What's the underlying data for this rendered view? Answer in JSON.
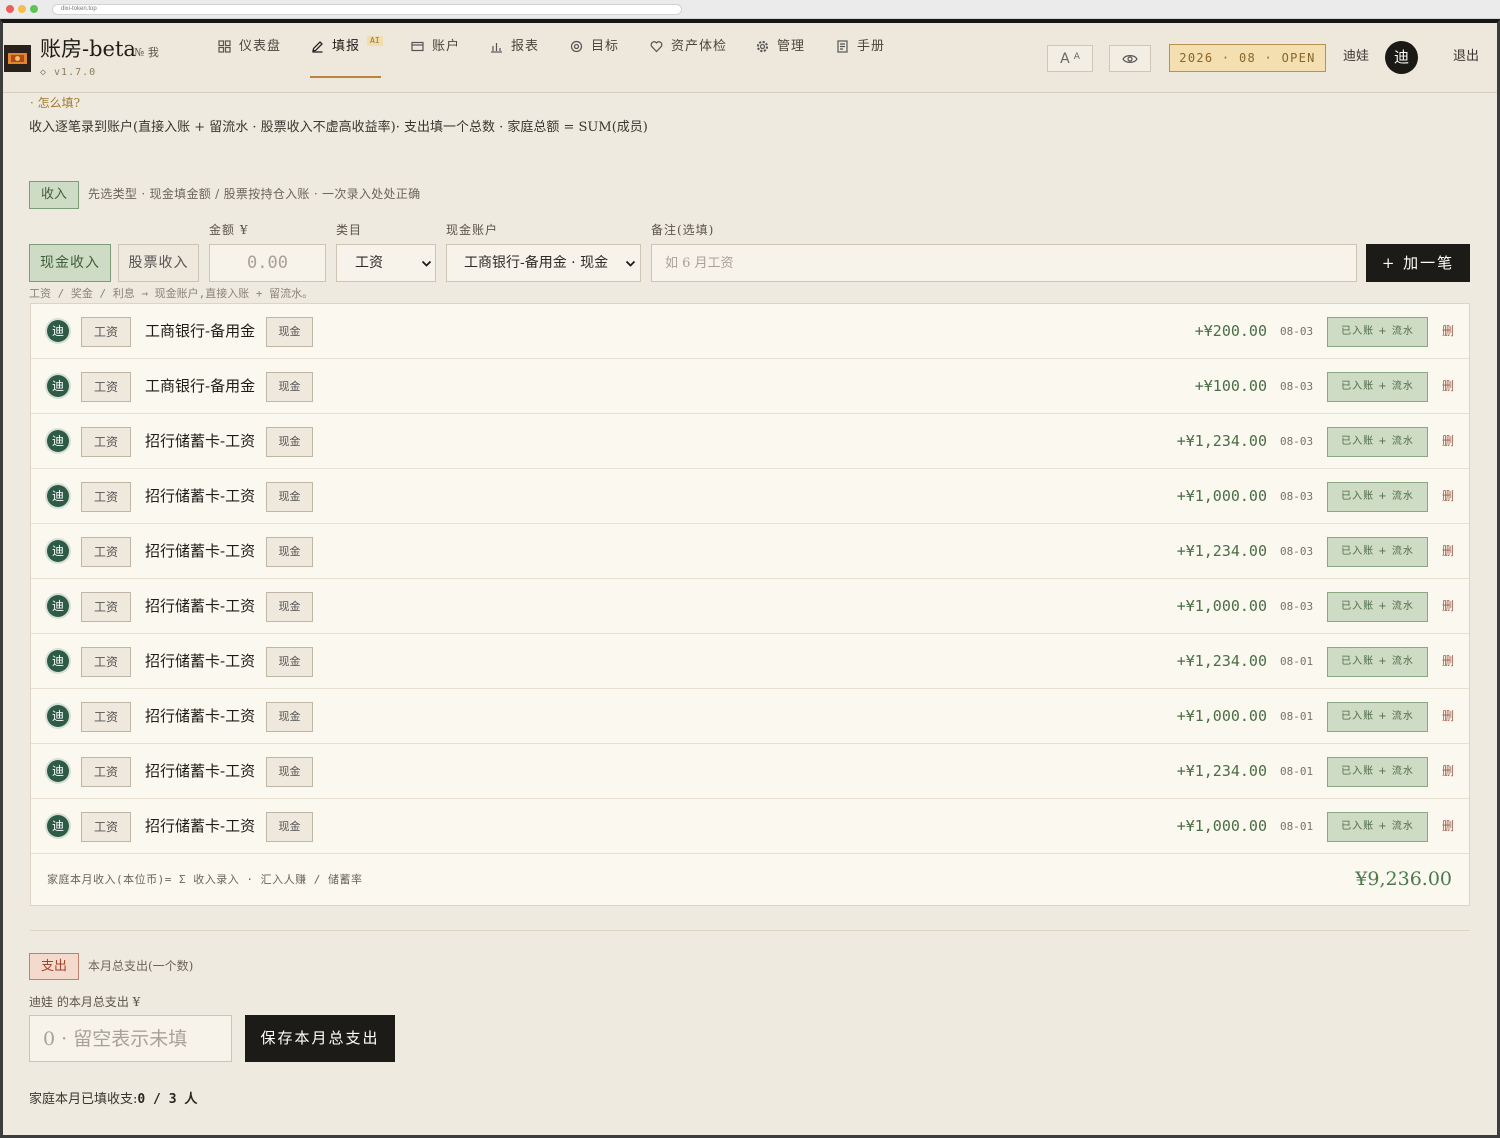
{
  "browser": {
    "url": "dixi-token.top"
  },
  "header": {
    "brand": "账房-beta",
    "brand_mark": "№ 我",
    "version": "◇ v1.7.0",
    "logo_icon": "ledger-logo-icon",
    "nav": [
      {
        "label": "仪表盘",
        "icon": "grid-icon"
      },
      {
        "label": "填报",
        "icon": "pencil-icon",
        "badge": "AI",
        "active": true
      },
      {
        "label": "账户",
        "icon": "card-icon"
      },
      {
        "label": "报表",
        "icon": "bar-chart-icon"
      },
      {
        "label": "目标",
        "icon": "target-icon"
      },
      {
        "label": "资产体检",
        "icon": "heart-icon"
      },
      {
        "label": "管理",
        "icon": "gear-icon"
      },
      {
        "label": "手册",
        "icon": "document-icon"
      }
    ],
    "font_toggle": {
      "large": "A",
      "small": "A"
    },
    "privacy_toggle_icon": "eye-icon",
    "period": "2026 · 08 · OPEN",
    "user_name": "迪娃",
    "avatar_initial": "迪",
    "logout": "退出"
  },
  "help": {
    "toggle": "· 怎么填?",
    "text": "收入逐笔录到账户(直接入账 + 留流水 · 股票收入不虚高收益率)· 支出填一个总数 · 家庭总额 = SUM(成员)"
  },
  "income": {
    "tag": "收入",
    "subtitle": "先选类型 · 现金填金额 / 股票按持仓入账 · 一次录入处处正确",
    "labels": {
      "amount": "金额 ¥",
      "category": "类目",
      "account": "现金账户",
      "note": "备注(选填)"
    },
    "types": [
      {
        "label": "现金收入",
        "selected": true
      },
      {
        "label": "股票收入",
        "selected": false
      }
    ],
    "amount_placeholder": "0.00",
    "category": "工资",
    "account": "工商银行-备用金 · 现金",
    "note_placeholder": "如 6 月工资",
    "add_button": "+ 加一笔",
    "hint": "工资 / 奖金 / 利息 → 现金账户,直接入账 + 留流水。",
    "entries": [
      {
        "member": "迪",
        "category": "工资",
        "account": "工商银行-备用金",
        "account_type": "现金",
        "amount": "+¥200.00",
        "date": "08-03",
        "status": "已入账 + 流水",
        "delete_label": "删"
      },
      {
        "member": "迪",
        "category": "工资",
        "account": "工商银行-备用金",
        "account_type": "现金",
        "amount": "+¥100.00",
        "date": "08-03",
        "status": "已入账 + 流水",
        "delete_label": "删"
      },
      {
        "member": "迪",
        "category": "工资",
        "account": "招行储蓄卡-工资",
        "account_type": "现金",
        "amount": "+¥1,234.00",
        "date": "08-03",
        "status": "已入账 + 流水",
        "delete_label": "删"
      },
      {
        "member": "迪",
        "category": "工资",
        "account": "招行储蓄卡-工资",
        "account_type": "现金",
        "amount": "+¥1,000.00",
        "date": "08-03",
        "status": "已入账 + 流水",
        "delete_label": "删"
      },
      {
        "member": "迪",
        "category": "工资",
        "account": "招行储蓄卡-工资",
        "account_type": "现金",
        "amount": "+¥1,234.00",
        "date": "08-03",
        "status": "已入账 + 流水",
        "delete_label": "删"
      },
      {
        "member": "迪",
        "category": "工资",
        "account": "招行储蓄卡-工资",
        "account_type": "现金",
        "amount": "+¥1,000.00",
        "date": "08-03",
        "status": "已入账 + 流水",
        "delete_label": "删"
      },
      {
        "member": "迪",
        "category": "工资",
        "account": "招行储蓄卡-工资",
        "account_type": "现金",
        "amount": "+¥1,234.00",
        "date": "08-01",
        "status": "已入账 + 流水",
        "delete_label": "删"
      },
      {
        "member": "迪",
        "category": "工资",
        "account": "招行储蓄卡-工资",
        "account_type": "现金",
        "amount": "+¥1,000.00",
        "date": "08-01",
        "status": "已入账 + 流水",
        "delete_label": "删"
      },
      {
        "member": "迪",
        "category": "工资",
        "account": "招行储蓄卡-工资",
        "account_type": "现金",
        "amount": "+¥1,234.00",
        "date": "08-01",
        "status": "已入账 + 流水",
        "delete_label": "删"
      },
      {
        "member": "迪",
        "category": "工资",
        "account": "招行储蓄卡-工资",
        "account_type": "现金",
        "amount": "+¥1,000.00",
        "date": "08-01",
        "status": "已入账 + 流水",
        "delete_label": "删"
      }
    ],
    "summary_label": "家庭本月收入(本位币)= Σ 收入录入 · 汇入人赚 / 储蓄率",
    "summary_total": "¥9,236.00"
  },
  "expense": {
    "tag": "支出",
    "subtitle": "本月总支出(一个数)",
    "label": "迪娃 的本月总支出 ¥",
    "placeholder": "0 · 留空表示未填",
    "save_button": "保存本月总支出"
  },
  "fill_status": {
    "label": "家庭本月已填收支:",
    "value": "0 / 3 人"
  },
  "colors": {
    "page_bg": "#efeadf",
    "income_accent": "#4a6e45",
    "income_tag_bg": "#cfdcc5",
    "expense_tag_bg": "#f4d9cd",
    "expense_accent": "#a0442c",
    "period_badge_bg": "#f3dfb0",
    "active_nav_underline": "#b8843f",
    "primary_button": "#1d1b18",
    "member_avatar": "#2e5a48"
  }
}
